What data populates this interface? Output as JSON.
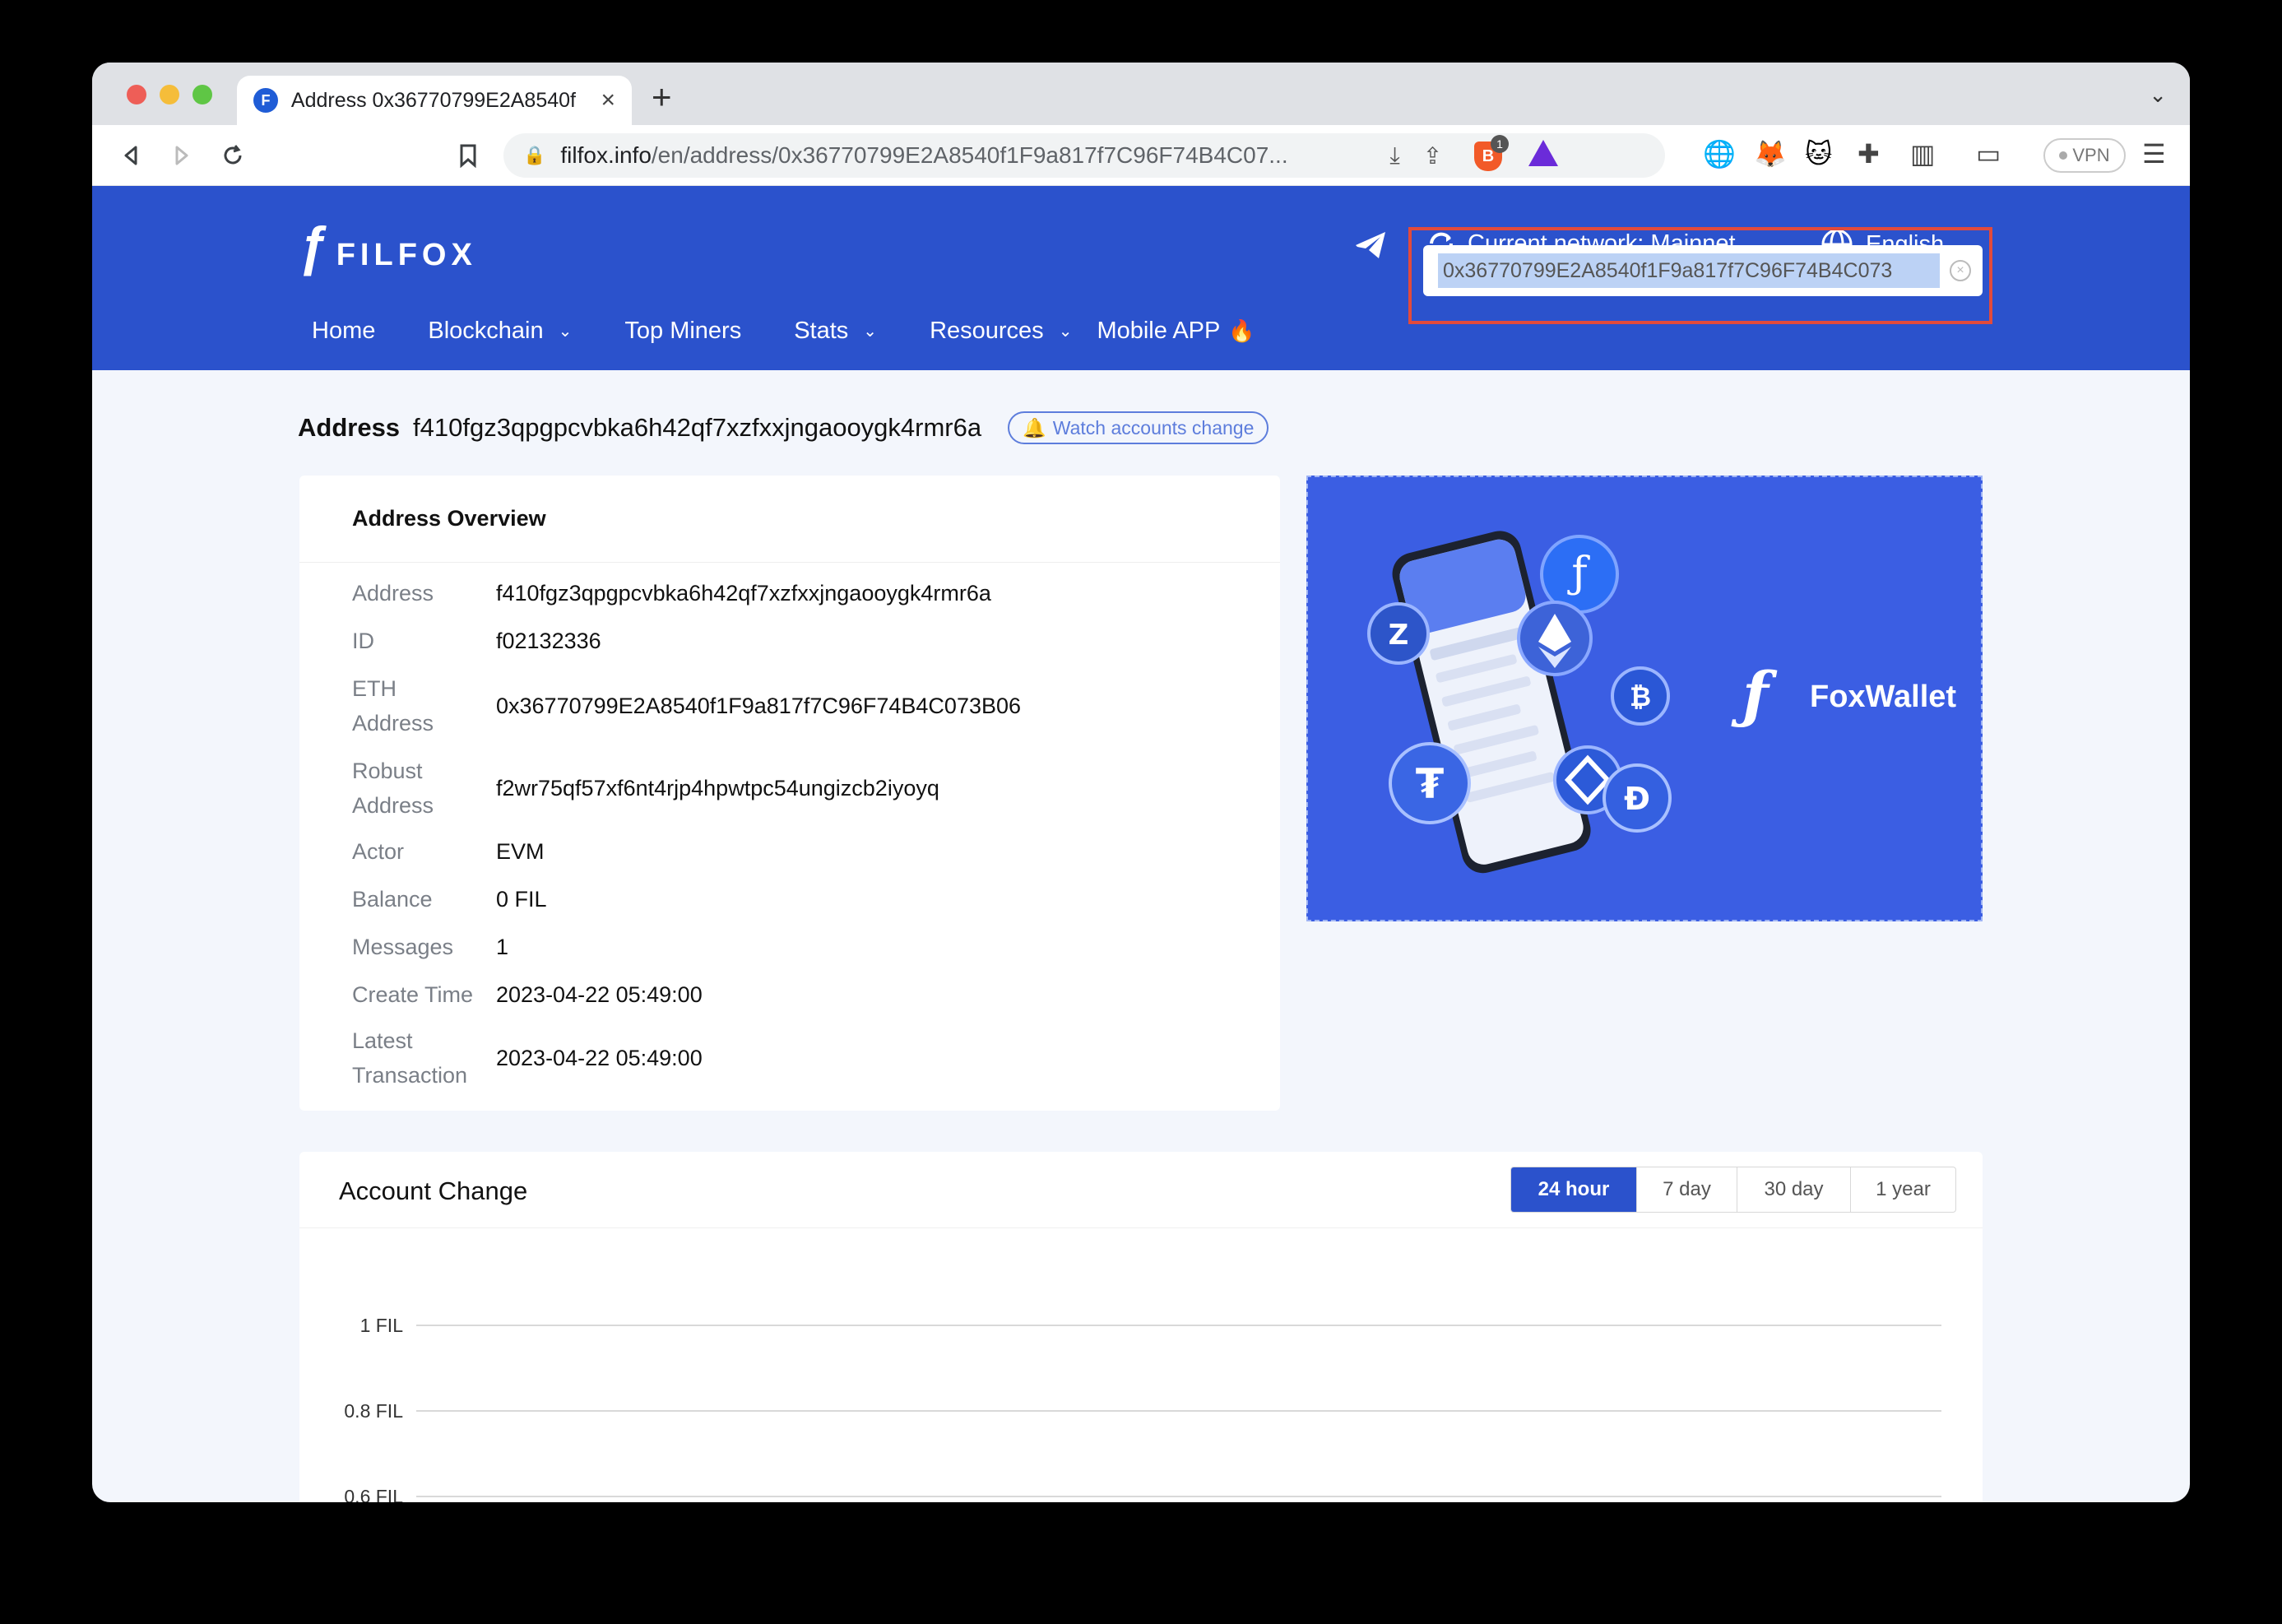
{
  "browser": {
    "tab_title": "Address 0x36770799E2A8540f",
    "url_host": "filfox.info",
    "url_path": "/en/address/0x36770799E2A8540f1F9a817f7C96F74B4C07...",
    "shield_count": "1",
    "vpn_label": "VPN"
  },
  "header": {
    "logo_text": "FILFOX",
    "network_label": "Current network: Mainnet",
    "language_label": "English",
    "nav": [
      {
        "label": "Home"
      },
      {
        "label": "Blockchain"
      },
      {
        "label": "Top Miners"
      },
      {
        "label": "Stats"
      },
      {
        "label": "Resources"
      },
      {
        "label": "Mobile APP"
      }
    ],
    "search_value": "0x36770799E2A8540f1F9a817f7C96F74B4C073"
  },
  "page": {
    "address_label": "Address",
    "address_value": "f410fgz3qpgpcvbka6h42qf7xzfxxjngaooygk4rmr6a",
    "watch_label": "Watch accounts change"
  },
  "overview": {
    "title": "Address Overview",
    "rows": [
      {
        "label": "Address",
        "value": "f410fgz3qpgpcvbka6h42qf7xzfxxjngaooygk4rmr6a"
      },
      {
        "label": "ID",
        "value": "f02132336"
      },
      {
        "label": "ETH Address",
        "value": "0x36770799E2A8540f1F9a817f7C96F74B4C073B06"
      },
      {
        "label": "Robust Address",
        "value": "f2wr75qf57xf6nt4rjp4hpwtpc54ungizcb2iyoyq"
      },
      {
        "label": "Actor",
        "value": "EVM"
      },
      {
        "label": "Balance",
        "value": "0 FIL"
      },
      {
        "label": "Messages",
        "value": "1"
      },
      {
        "label": "Create Time",
        "value": "2023-04-22 05:49:00"
      },
      {
        "label": "Latest Transaction",
        "value": "2023-04-22 05:49:00"
      }
    ]
  },
  "banner": {
    "brand": "FoxWallet"
  },
  "account_change": {
    "title": "Account Change",
    "ranges": [
      {
        "label": "24 hour",
        "active": true
      },
      {
        "label": "7 day",
        "active": false
      },
      {
        "label": "30 day",
        "active": false
      },
      {
        "label": "1 year",
        "active": false
      }
    ]
  },
  "chart_data": {
    "type": "line",
    "title": "Account Change",
    "ylabel": "",
    "xlabel": "",
    "y_ticks": [
      "1 FIL",
      "0.8 FIL",
      "0.6 FIL"
    ],
    "y_tick_values": [
      1,
      0.8,
      0.6
    ],
    "series": [],
    "grid": true
  },
  "colors": {
    "brand_blue": "#2b52cc",
    "highlight_red": "#e24a3b"
  }
}
